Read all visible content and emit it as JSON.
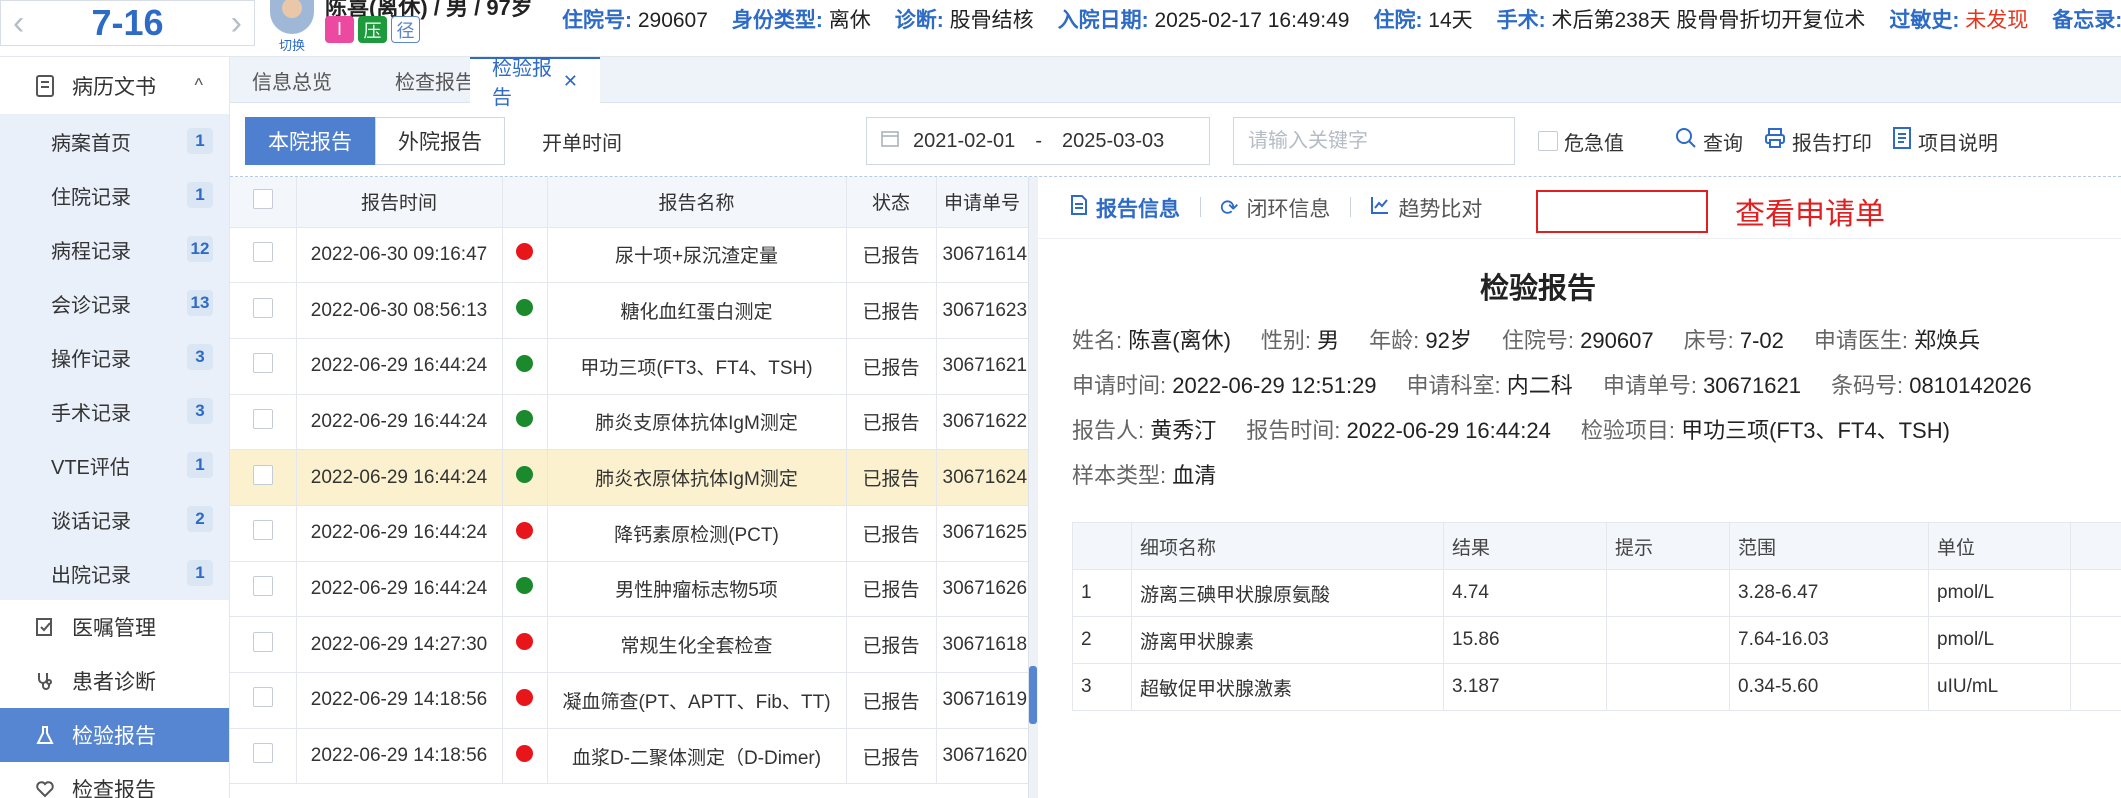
{
  "header": {
    "bed_number": "7-16",
    "switch_label": "切换",
    "patient_title": "陈喜(离休) / 男 / 97岁",
    "tags": [
      {
        "text": "I",
        "color": "#ec4aa0"
      },
      {
        "text": "压",
        "color": "#1c9a3c"
      },
      {
        "text": "径",
        "color": "#5a86c9"
      }
    ],
    "fields": [
      {
        "label": "住院号:",
        "value": "290607"
      },
      {
        "label": "身份类型:",
        "value": "离休"
      },
      {
        "label": "诊断:",
        "value": "股骨结核"
      },
      {
        "label": "入院日期:",
        "value": "2025-02-17 16:49:49"
      },
      {
        "label": "住院:",
        "value": "14天"
      },
      {
        "label": "手术:",
        "value": "术后第238天 股骨骨折切开复位术"
      },
      {
        "label": "过敏史:",
        "value": "未发现"
      },
      {
        "label": "备忘录:",
        "value": ""
      }
    ]
  },
  "sidebar": {
    "section_title": "病历文书",
    "sub_items": [
      {
        "label": "病案首页",
        "count": "1"
      },
      {
        "label": "住院记录",
        "count": "1"
      },
      {
        "label": "病程记录",
        "count": "12"
      },
      {
        "label": "会诊记录",
        "count": "13"
      },
      {
        "label": "操作记录",
        "count": "3"
      },
      {
        "label": "手术记录",
        "count": "3"
      },
      {
        "label": "VTE评估",
        "count": "1"
      },
      {
        "label": "谈话记录",
        "count": "2"
      },
      {
        "label": "出院记录",
        "count": "1"
      }
    ],
    "main_items": [
      {
        "label": "医嘱管理",
        "icon": "orders-icon"
      },
      {
        "label": "患者诊断",
        "icon": "stethoscope-icon"
      },
      {
        "label": "检验报告",
        "icon": "flask-icon"
      },
      {
        "label": "检查报告",
        "icon": "heart-icon"
      }
    ]
  },
  "tabs": [
    "信息总览",
    "检查报告",
    "检验报告"
  ],
  "toolbar": {
    "seg_internal": "本院报告",
    "seg_external": "外院报告",
    "date_label": "开单时间",
    "date_from": "2021-02-01",
    "date_sep": "-",
    "date_to": "2025-03-03",
    "search_placeholder": "请输入关键字",
    "critical_label": "危急值",
    "query_label": "查询",
    "print_label": "报告打印",
    "explain_label": "项目说明"
  },
  "list": {
    "columns": [
      "报告时间",
      "报告名称",
      "状态",
      "申请单号"
    ],
    "rows": [
      {
        "time": "2022-06-30 09:16:47",
        "dot": "#e8161a",
        "name": "尿十项+尿沉渣定量",
        "status": "已报告",
        "no": "30671614"
      },
      {
        "time": "2022-06-30 08:56:13",
        "dot": "#1a8a2c",
        "name": "糖化血红蛋白测定",
        "status": "已报告",
        "no": "30671623"
      },
      {
        "time": "2022-06-29 16:44:24",
        "dot": "#1a8a2c",
        "name": "甲功三项(FT3、FT4、TSH)",
        "status": "已报告",
        "no": "30671621"
      },
      {
        "time": "2022-06-29 16:44:24",
        "dot": "#1a8a2c",
        "name": "肺炎支原体抗体IgM测定",
        "status": "已报告",
        "no": "30671622"
      },
      {
        "time": "2022-06-29 16:44:24",
        "dot": "#1a8a2c",
        "name": "肺炎衣原体抗体IgM测定",
        "status": "已报告",
        "no": "30671624"
      },
      {
        "time": "2022-06-29 16:44:24",
        "dot": "#e8161a",
        "name": "降钙素原检测(PCT)",
        "status": "已报告",
        "no": "30671625"
      },
      {
        "time": "2022-06-29 16:44:24",
        "dot": "#1a8a2c",
        "name": "男性肿瘤标志物5项",
        "status": "已报告",
        "no": "30671626"
      },
      {
        "time": "2022-06-29 14:27:30",
        "dot": "#e8161a",
        "name": "常规生化全套检查",
        "status": "已报告",
        "no": "30671618"
      },
      {
        "time": "2022-06-29 14:18:56",
        "dot": "#e8161a",
        "name": "凝血筛查(PT、APTT、Fib、TT)",
        "status": "已报告",
        "no": "30671619"
      },
      {
        "time": "2022-06-29 14:18:56",
        "dot": "#e8161a",
        "name": "血浆D-二聚体测定（D-Dimer)",
        "status": "已报告",
        "no": "30671620"
      }
    ],
    "selected_index": 4
  },
  "report": {
    "tabs": [
      "报告信息",
      "闭环信息",
      "趋势比对"
    ],
    "apply_link": "查看申请单",
    "title": "检验报告",
    "row1": [
      {
        "k": "姓名:",
        "v": "陈喜(离休)"
      },
      {
        "k": "性别:",
        "v": "男"
      },
      {
        "k": "年龄:",
        "v": "92岁"
      },
      {
        "k": "住院号:",
        "v": "290607"
      },
      {
        "k": "床号:",
        "v": "7-02"
      },
      {
        "k": "申请医生:",
        "v": "郑焕兵"
      }
    ],
    "row2": [
      {
        "k": "申请时间:",
        "v": "2022-06-29 12:51:29"
      },
      {
        "k": "申请科室:",
        "v": "内二科"
      },
      {
        "k": "申请单号:",
        "v": "30671621"
      },
      {
        "k": "条码号:",
        "v": "0810142026"
      }
    ],
    "row3": [
      {
        "k": "报告人:",
        "v": "黄秀汀"
      },
      {
        "k": "报告时间:",
        "v": "2022-06-29 16:44:24"
      },
      {
        "k": "检验项目:",
        "v": "甲功三项(FT3、FT4、TSH)"
      }
    ],
    "row4": [
      {
        "k": "样本类型:",
        "v": "血清"
      }
    ],
    "detail_columns": [
      "",
      "细项名称",
      "结果",
      "提示",
      "范围",
      "单位"
    ],
    "detail_rows": [
      [
        "1",
        "游离三碘甲状腺原氨酸",
        "4.74",
        "",
        "3.28-6.47",
        "pmol/L"
      ],
      [
        "2",
        "游离甲状腺素",
        "15.86",
        "",
        "7.64-16.03",
        "pmol/L"
      ],
      [
        "3",
        "超敏促甲状腺激素",
        "3.187",
        "",
        "0.34-5.60",
        "uIU/mL"
      ]
    ]
  }
}
